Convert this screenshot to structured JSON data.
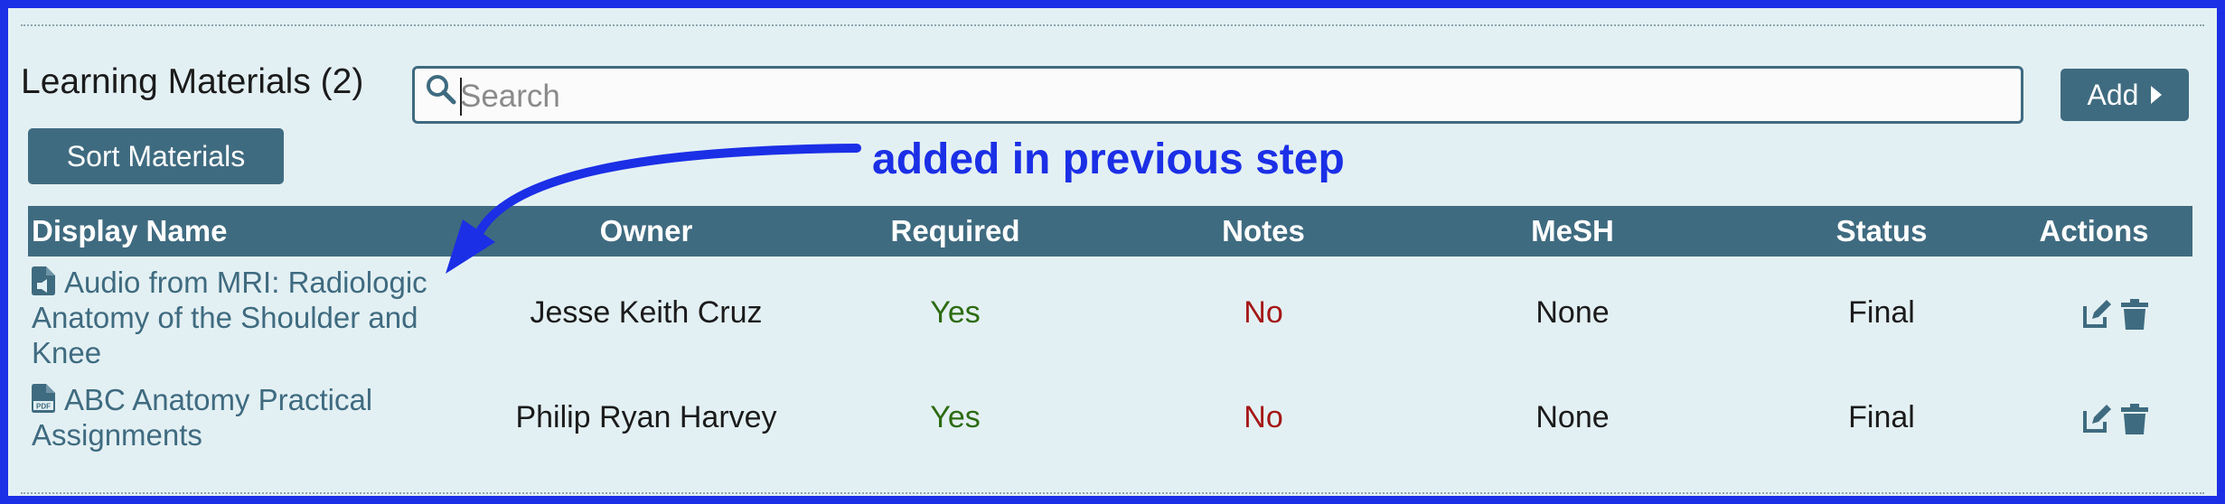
{
  "section": {
    "title": "Learning Materials (2)",
    "search_placeholder": "Search",
    "add_label": "Add",
    "sort_label": "Sort Materials"
  },
  "annotation": {
    "text": "added in previous step",
    "color": "#1b2fe6"
  },
  "table": {
    "headers": {
      "display_name": "Display Name",
      "owner": "Owner",
      "required": "Required",
      "notes": "Notes",
      "mesh": "MeSH",
      "status": "Status",
      "actions": "Actions"
    },
    "rows": [
      {
        "icon": "audio-file-icon",
        "display_name": "Audio from MRI: Radiologic Anatomy of the Shoulder and Knee",
        "owner": "Jesse Keith Cruz",
        "required": "Yes",
        "notes": "No",
        "mesh": "None",
        "status": "Final"
      },
      {
        "icon": "pdf-file-icon",
        "display_name": "ABC Anatomy Practical Assignments",
        "owner": "Philip Ryan Harvey",
        "required": "Yes",
        "notes": "No",
        "mesh": "None",
        "status": "Final"
      }
    ]
  },
  "colors": {
    "primary": "#3f6b80",
    "background": "#e3f0f3",
    "yes": "#2c6b12",
    "no": "#a51616"
  }
}
